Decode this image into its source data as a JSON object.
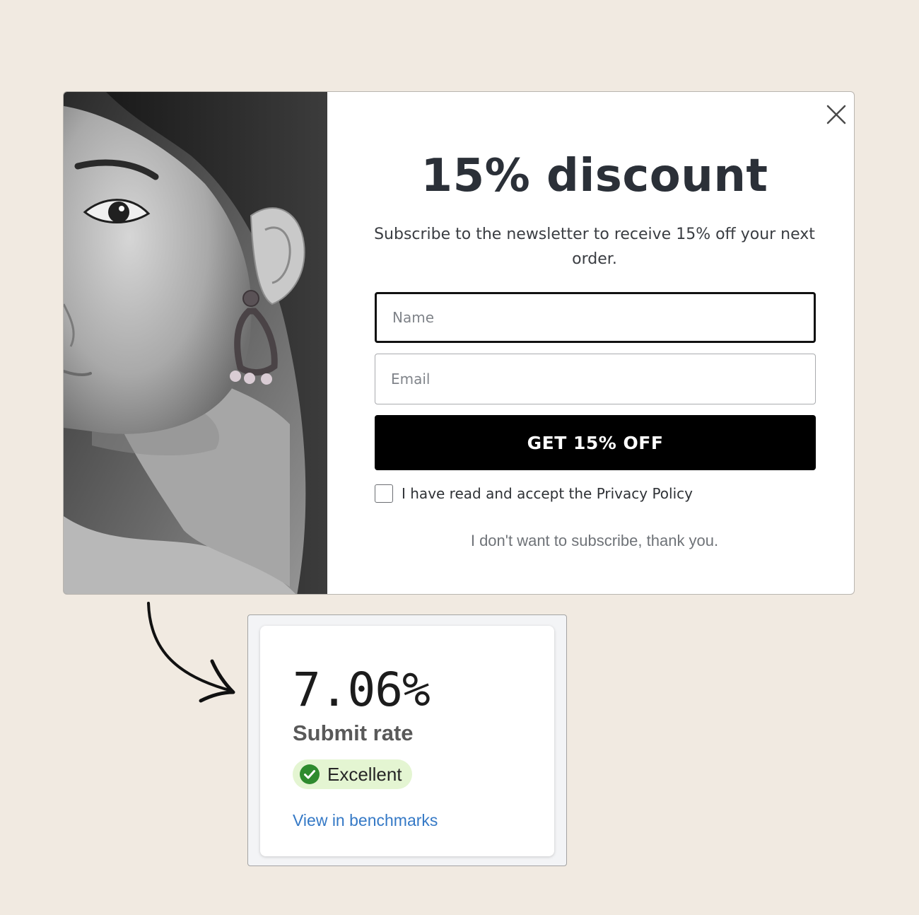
{
  "popup": {
    "headline": "15% discount",
    "subtitle": "Subscribe to the newsletter to receive 15% off your next order.",
    "name_placeholder": "Name",
    "email_placeholder": "Email",
    "cta_label": "GET 15% OFF",
    "consent_label": "I have read and accept the Privacy Policy",
    "decline_label": "I don't want to subscribe, thank you.",
    "close_icon": "close-icon",
    "image_subject": "black-and-white portrait of a woman wearing a drop earring"
  },
  "metric_card": {
    "value": "7.06%",
    "label": "Submit rate",
    "status": "Excellent",
    "status_icon": "check-circle-icon",
    "link": "View in benchmarks"
  },
  "colors": {
    "background": "#f1eae1",
    "cta_background": "#000000",
    "headline": "#2b3038",
    "badge_background": "#e4f5d2",
    "badge_icon": "#2e8b2e",
    "link": "#3579c6"
  }
}
